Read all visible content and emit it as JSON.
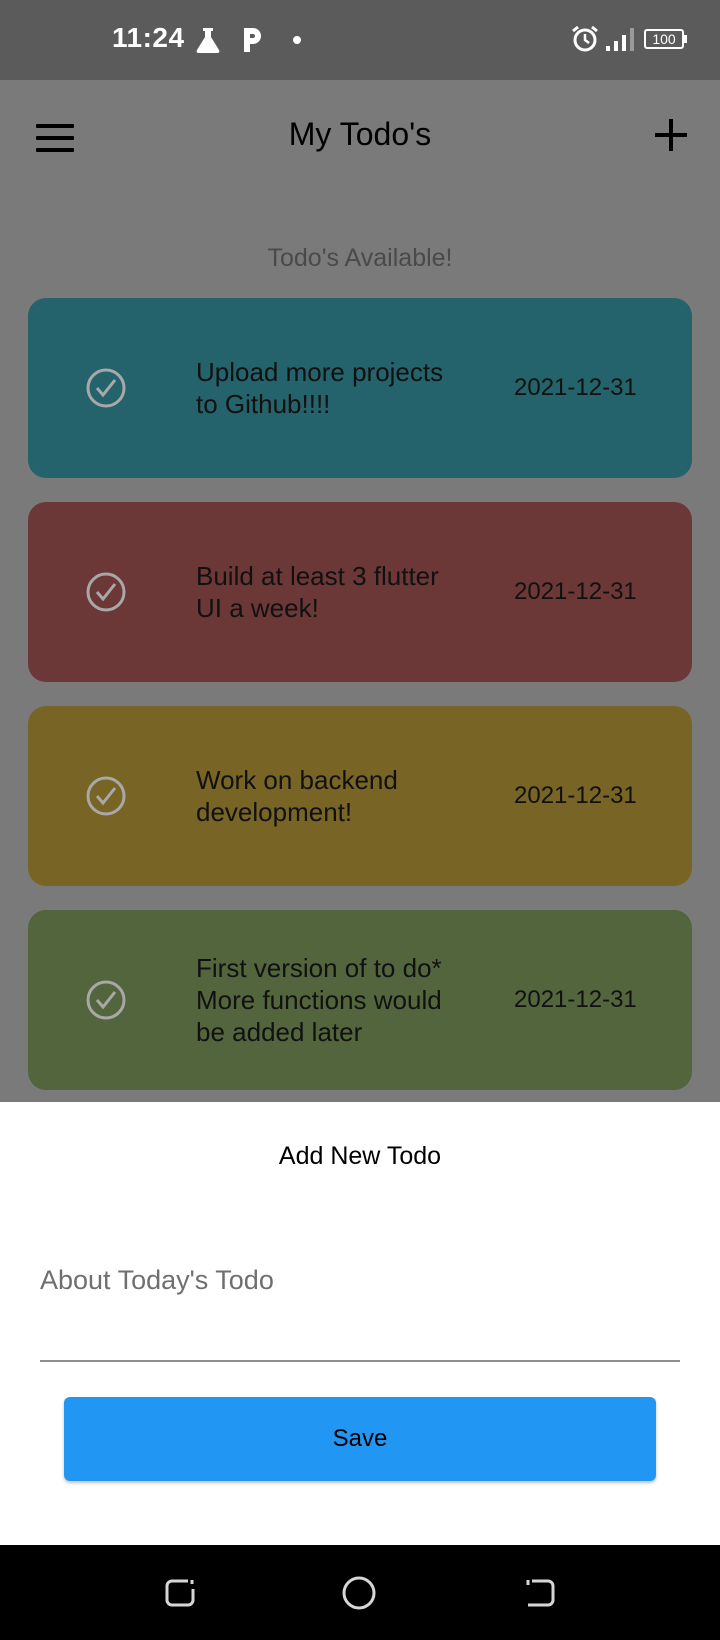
{
  "status_bar": {
    "time": "11:24",
    "battery": "100",
    "icons": [
      "flask-icon",
      "parking-p-icon",
      "notification-dot-icon",
      "alarm-icon",
      "signal-icon",
      "battery-icon"
    ]
  },
  "app_bar": {
    "title": "My Todo's",
    "menu_icon": "hamburger-menu-icon",
    "add_icon": "plus-icon"
  },
  "todos_header": "Todo's Available!",
  "todos": [
    {
      "text": "Upload more projects to Github!!!!",
      "date": "2021-12-31",
      "color": "#24636b"
    },
    {
      "text": "Build at least 3 flutter UI a week!",
      "date": "2021-12-31",
      "color": "#6c3737"
    },
    {
      "text": "Work on backend development!",
      "date": "2021-12-31",
      "color": "#786425"
    },
    {
      "text": "First version of to do* More functions would be added later",
      "date": "2021-12-31",
      "color": "#53653d"
    }
  ],
  "sheet": {
    "title": "Add New Todo",
    "input_placeholder": "About Today's Todo",
    "input_value": "",
    "save_label": "Save",
    "save_color": "#2196f3"
  },
  "nav_bar": {
    "icons": [
      "recents-icon",
      "home-icon",
      "back-icon"
    ]
  }
}
